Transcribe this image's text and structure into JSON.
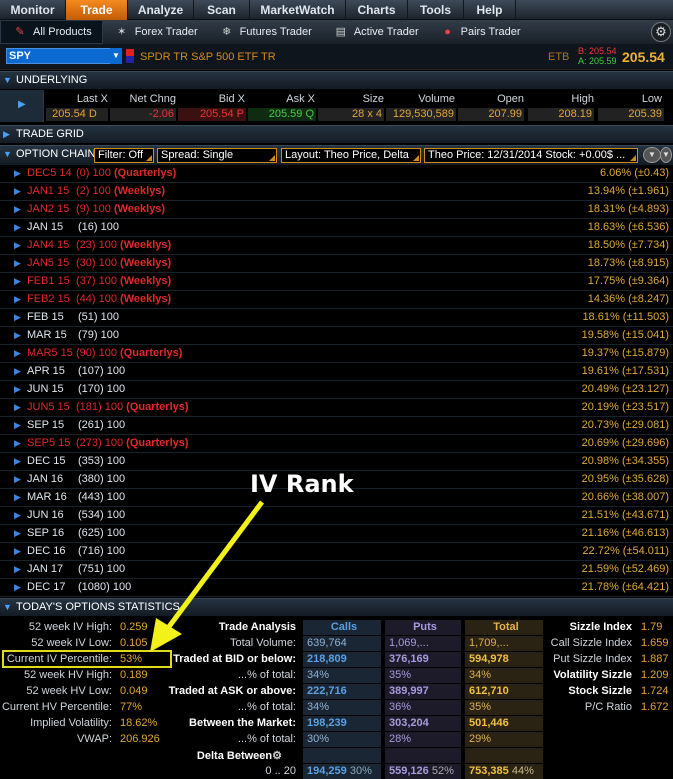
{
  "menu": [
    "Monitor",
    "Trade",
    "Analyze",
    "Scan",
    "MarketWatch",
    "Charts",
    "Tools",
    "Help"
  ],
  "menu_active": "Trade",
  "toolbar": {
    "items": [
      {
        "label": "All Products",
        "icon": "all-products-icon"
      },
      {
        "label": "Forex Trader",
        "icon": "forex-icon"
      },
      {
        "label": "Futures Trader",
        "icon": "futures-icon"
      },
      {
        "label": "Active Trader",
        "icon": "active-trader-icon"
      },
      {
        "label": "Pairs Trader",
        "icon": "pairs-icon"
      }
    ]
  },
  "symbol": {
    "ticker": "SPY",
    "name": "SPDR TR S&P 500 ETF TR",
    "etb": "ETB",
    "bid_line": "B: 205.54",
    "ask_line": "A: 205.59",
    "last": "205.54"
  },
  "underlying": {
    "title": "UNDERLYING",
    "headers": [
      "Last X",
      "Net Chng",
      "Bid X",
      "Ask X",
      "Size",
      "Volume",
      "Open",
      "High",
      "Low"
    ],
    "values": {
      "last": "205.54",
      "last_x": "D",
      "net_chng": "-2.06",
      "bid": "205.54",
      "bid_x": "P",
      "ask": "205.59",
      "ask_x": "Q",
      "size": "28 x 4",
      "volume": "129,530,589",
      "open": "207.99",
      "high": "208.19",
      "low": "205.39"
    }
  },
  "trade_grid": {
    "title": "TRADE GRID"
  },
  "option_chain": {
    "title": "OPTION CHAIN",
    "filter": "Filter: Off",
    "spread": "Spread: Single",
    "layout": "Layout: Theo Price, Delta",
    "theo": "Theo Price: 12/31/2014  Stock: +0.00$  ...",
    "rows": [
      {
        "exp": "DEC5 14",
        "days": "(0)",
        "mult": "100",
        "tag": "(Quarterlys)",
        "iv": "6.06% (±0.43)",
        "special": true
      },
      {
        "exp": "JAN1 15",
        "days": "(2)",
        "mult": "100",
        "tag": "(Weeklys)",
        "iv": "13.94% (±1.961)",
        "special": true
      },
      {
        "exp": "JAN2 15",
        "days": "(9)",
        "mult": "100",
        "tag": "(Weeklys)",
        "iv": "18.31% (±4.893)",
        "special": true
      },
      {
        "exp": "JAN 15",
        "days": "(16)",
        "mult": "100",
        "tag": "",
        "iv": "18.63% (±6.536)",
        "special": false
      },
      {
        "exp": "JAN4 15",
        "days": "(23)",
        "mult": "100",
        "tag": "(Weeklys)",
        "iv": "18.50% (±7.734)",
        "special": true
      },
      {
        "exp": "JAN5 15",
        "days": "(30)",
        "mult": "100",
        "tag": "(Weeklys)",
        "iv": "18.73% (±8.915)",
        "special": true
      },
      {
        "exp": "FEB1 15",
        "days": "(37)",
        "mult": "100",
        "tag": "(Weeklys)",
        "iv": "17.75% (±9.364)",
        "special": true
      },
      {
        "exp": "FEB2 15",
        "days": "(44)",
        "mult": "100",
        "tag": "(Weeklys)",
        "iv": "14.36% (±8.247)",
        "special": true
      },
      {
        "exp": "FEB 15",
        "days": "(51)",
        "mult": "100",
        "tag": "",
        "iv": "18.61% (±11.503)",
        "special": false
      },
      {
        "exp": "MAR 15",
        "days": "(79)",
        "mult": "100",
        "tag": "",
        "iv": "19.58% (±15.041)",
        "special": false
      },
      {
        "exp": "MAR5 15",
        "days": "(90)",
        "mult": "100",
        "tag": "(Quarterlys)",
        "iv": "19.37% (±15.879)",
        "special": true
      },
      {
        "exp": "APR 15",
        "days": "(107)",
        "mult": "100",
        "tag": "",
        "iv": "19.61% (±17.531)",
        "special": false
      },
      {
        "exp": "JUN 15",
        "days": "(170)",
        "mult": "100",
        "tag": "",
        "iv": "20.49% (±23.127)",
        "special": false
      },
      {
        "exp": "JUN5 15",
        "days": "(181)",
        "mult": "100",
        "tag": "(Quarterlys)",
        "iv": "20.19% (±23.517)",
        "special": true
      },
      {
        "exp": "SEP 15",
        "days": "(261)",
        "mult": "100",
        "tag": "",
        "iv": "20.73% (±29.081)",
        "special": false
      },
      {
        "exp": "SEP5 15",
        "days": "(273)",
        "mult": "100",
        "tag": "(Quarterlys)",
        "iv": "20.69% (±29.696)",
        "special": true
      },
      {
        "exp": "DEC 15",
        "days": "(353)",
        "mult": "100",
        "tag": "",
        "iv": "20.98% (±34.355)",
        "special": false
      },
      {
        "exp": "JAN 16",
        "days": "(380)",
        "mult": "100",
        "tag": "",
        "iv": "20.95% (±35.628)",
        "special": false
      },
      {
        "exp": "MAR 16",
        "days": "(443)",
        "mult": "100",
        "tag": "",
        "iv": "20.66% (±38.007)",
        "special": false
      },
      {
        "exp": "JUN 16",
        "days": "(534)",
        "mult": "100",
        "tag": "",
        "iv": "21.51% (±43.671)",
        "special": false
      },
      {
        "exp": "SEP 16",
        "days": "(625)",
        "mult": "100",
        "tag": "",
        "iv": "21.16% (±46.613)",
        "special": false
      },
      {
        "exp": "DEC 16",
        "days": "(716)",
        "mult": "100",
        "tag": "",
        "iv": "22.72% (±54.011)",
        "special": false
      },
      {
        "exp": "JAN 17",
        "days": "(751)",
        "mult": "100",
        "tag": "",
        "iv": "21.59% (±52.469)",
        "special": false
      },
      {
        "exp": "DEC 17",
        "days": "(1080)",
        "mult": "100",
        "tag": "",
        "iv": "21.78% (±64.421)",
        "special": false
      }
    ]
  },
  "stats": {
    "title": "TODAY'S OPTIONS STATISTICS",
    "left": [
      {
        "label": "52 week IV High:",
        "value": "0.259"
      },
      {
        "label": "52 week IV Low:",
        "value": "0.105"
      },
      {
        "label": "Current IV Percentile:",
        "value": "53%"
      },
      {
        "label": "52 week HV High:",
        "value": "0.189"
      },
      {
        "label": "52 week HV Low:",
        "value": "0.049"
      },
      {
        "label": "Current HV Percentile:",
        "value": "77%"
      },
      {
        "label": "Implied Volatility:",
        "value": "18.62%"
      },
      {
        "label": "VWAP:",
        "value": "206.926"
      }
    ],
    "trade_analysis": {
      "header": "Trade Analysis",
      "calls_h": "Calls",
      "puts_h": "Puts",
      "total_h": "Total",
      "rows": [
        {
          "label": "Total Volume:",
          "calls": "639,764",
          "puts": "1,069,...",
          "total": "1,709,...",
          "bold": false,
          "emph": false
        },
        {
          "label": "Traded at BID or below:",
          "calls": "218,809",
          "puts": "376,169",
          "total": "594,978",
          "bold": true,
          "emph": true
        },
        {
          "label": "...% of total:",
          "calls": "34%",
          "puts": "35%",
          "total": "34%",
          "bold": false,
          "emph": false
        },
        {
          "label": "Traded at ASK or above:",
          "calls": "222,716",
          "puts": "389,997",
          "total": "612,710",
          "bold": true,
          "emph": true
        },
        {
          "label": "...% of total:",
          "calls": "34%",
          "puts": "36%",
          "total": "35%",
          "bold": false,
          "emph": false
        },
        {
          "label": "Between the Market:",
          "calls": "198,239",
          "puts": "303,204",
          "total": "501,446",
          "bold": true,
          "emph": true
        },
        {
          "label": "...% of total:",
          "calls": "30%",
          "puts": "28%",
          "total": "29%",
          "bold": false,
          "emph": false
        },
        {
          "label": "Delta Between",
          "calls": "",
          "puts": "",
          "total": "",
          "bold": true,
          "emph": false
        }
      ],
      "bottom_row": {
        "range": "0 .. 20",
        "calls": "194,259",
        "calls_pct": "30%",
        "puts": "559,126",
        "puts_pct": "52%",
        "total": "753,385",
        "total_pct": "44%"
      }
    },
    "sizzle": [
      {
        "label": "Sizzle Index",
        "value": "1.79",
        "bold": true
      },
      {
        "label": "Call Sizzle Index",
        "value": "1.659",
        "bold": false
      },
      {
        "label": "Put Sizzle Index",
        "value": "1.887",
        "bold": false
      },
      {
        "label": "Volatility Sizzle",
        "value": "1.209",
        "bold": true
      },
      {
        "label": "Stock Sizzle",
        "value": "1.724",
        "bold": true
      },
      {
        "label": "P/C Ratio",
        "value": "1.672",
        "bold": false
      }
    ]
  },
  "annotation": {
    "text": "IV Rank",
    "color": "#f2f21a"
  }
}
